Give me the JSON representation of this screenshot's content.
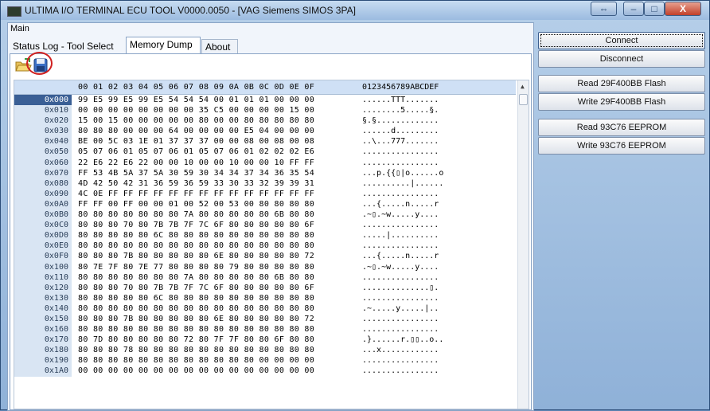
{
  "window": {
    "title": "ULTIMA I/O TERMINAL ECU TOOL V0000.0050 - [VAG Siemens SIMOS 3PA]",
    "buttons": {
      "restore": "⇔",
      "minimize": "–",
      "maximize": "□",
      "close": "X"
    }
  },
  "main": {
    "group_label": "Main",
    "tabs": [
      {
        "label": "Status Log - Tool Select",
        "active": false
      },
      {
        "label": "Memory Dump",
        "active": true
      },
      {
        "label": "About",
        "active": false
      }
    ],
    "toolbar": {
      "open_icon": "folder-open-icon",
      "save_icon": "floppy-save-icon",
      "highlight_color": "#d02020"
    }
  },
  "hex": {
    "header_bytes": "00 01 02 03 04 05 06 07 08 09 0A 0B 0C 0D 0E 0F",
    "header_ascii": "0123456789ABCDEF",
    "rows": [
      {
        "addr": "0x000",
        "bytes": "99 E5 99 E5 99 E5 54 54 54 00 01 01 01 00 00 00",
        "ascii": "......TTT.......",
        "selected": true
      },
      {
        "addr": "0x010",
        "bytes": "00 00 00 00 00 00 00 00 35 C5 00 00 00 00 15 00",
        "ascii": "........5.....§."
      },
      {
        "addr": "0x020",
        "bytes": "15 00 15 00 00 00 00 00 80 00 00 80 80 80 80 80",
        "ascii": "§.§............."
      },
      {
        "addr": "0x030",
        "bytes": "80 80 80 00 00 00 64 00 00 00 00 E5 04 00 00 00",
        "ascii": "......d........."
      },
      {
        "addr": "0x040",
        "bytes": "BE 00 5C 03 1E 01 37 37 37 00 00 08 00 08 00 08",
        "ascii": "..\\...777......."
      },
      {
        "addr": "0x050",
        "bytes": "05 07 06 01 05 07 06 01 05 07 06 01 02 02 02 E6",
        "ascii": "................"
      },
      {
        "addr": "0x060",
        "bytes": "22 E6 22 E6 22 00 00 10 00 00 10 00 00 10 FF FF",
        "ascii": "................"
      },
      {
        "addr": "0x070",
        "bytes": "FF 53 4B 5A 37 5A 30 59 30 34 34 37 34 36 35 54",
        "ascii": "...p.{{▯|o......o"
      },
      {
        "addr": "0x080",
        "bytes": "4D 42 50 42 31 36 59 36 59 33 30 33 32 39 39 31",
        "ascii": "..........|......"
      },
      {
        "addr": "0x090",
        "bytes": "4C 0E FF FF FF FF FF FF FF FF FF FF FF FF FF FF",
        "ascii": "................"
      },
      {
        "addr": "0x0A0",
        "bytes": "FF FF 00 FF 00 00 01 00 52 00 53 00 80 80 80 80",
        "ascii": "...{.....n.....r"
      },
      {
        "addr": "0x0B0",
        "bytes": "80 80 80 80 80 80 80 7A 80 80 80 80 80 6B 80 80",
        "ascii": ".~▯.~w.....y...."
      },
      {
        "addr": "0x0C0",
        "bytes": "80 80 80 70 80 7B 7B 7F 7C 6F 80 80 80 80 80 6F",
        "ascii": "................"
      },
      {
        "addr": "0x0D0",
        "bytes": "80 80 80 80 80 6C 80 80 80 80 80 80 80 80 80 80",
        "ascii": ".....|.........."
      },
      {
        "addr": "0x0E0",
        "bytes": "80 80 80 80 80 80 80 80 80 80 80 80 80 80 80 80",
        "ascii": "................"
      },
      {
        "addr": "0x0F0",
        "bytes": "80 80 80 7B 80 80 80 80 80 6E 80 80 80 80 80 72",
        "ascii": "...{.....n.....r"
      },
      {
        "addr": "0x100",
        "bytes": "80 7E 7F 80 7E 77 80 80 80 80 79 80 80 80 80 80",
        "ascii": ".~▯.~w.....y...."
      },
      {
        "addr": "0x110",
        "bytes": "80 80 80 80 80 80 80 7A 80 80 80 80 80 6B 80 80",
        "ascii": "................"
      },
      {
        "addr": "0x120",
        "bytes": "80 80 80 70 80 7B 7B 7F 7C 6F 80 80 80 80 80 6F",
        "ascii": "..............▯."
      },
      {
        "addr": "0x130",
        "bytes": "80 80 80 80 80 6C 80 80 80 80 80 80 80 80 80 80",
        "ascii": "................"
      },
      {
        "addr": "0x140",
        "bytes": "80 80 80 80 80 80 80 80 80 80 80 80 80 80 80 80",
        "ascii": ".~.....y.....|.."
      },
      {
        "addr": "0x150",
        "bytes": "80 80 80 7B 80 80 80 80 80 6E 80 80 80 80 80 72",
        "ascii": "................"
      },
      {
        "addr": "0x160",
        "bytes": "80 80 80 80 80 80 80 80 80 80 80 80 80 80 80 80",
        "ascii": "................"
      },
      {
        "addr": "0x170",
        "bytes": "80 7D 80 80 80 80 80 72 80 7F 7F 80 80 6F 80 80",
        "ascii": ".}......r.▯▯..o.."
      },
      {
        "addr": "0x180",
        "bytes": "80 80 80 78 80 80 80 80 80 80 80 80 80 80 80 80",
        "ascii": "...x............"
      },
      {
        "addr": "0x190",
        "bytes": "80 80 80 80 80 80 80 80 80 80 80 80 00 00 00 00",
        "ascii": "................"
      },
      {
        "addr": "0x1A0",
        "bytes": "00 00 00 00 00 00 00 00 00 00 00 00 00 00 00 00",
        "ascii": "................"
      }
    ]
  },
  "actions": [
    {
      "label": "Connect",
      "focused": true
    },
    {
      "label": "Disconnect"
    },
    {
      "label": "Read 29F400BB Flash"
    },
    {
      "label": "Write 29F400BB Flash"
    },
    {
      "label": "Read 93C76 EEPROM"
    },
    {
      "label": "Write 93C76 EEPROM"
    }
  ]
}
